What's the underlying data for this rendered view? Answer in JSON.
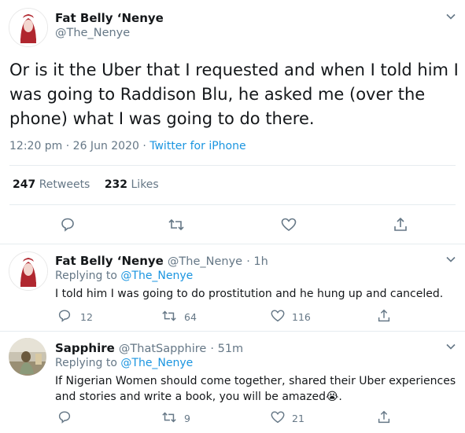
{
  "main_tweet": {
    "author_name": "Fat Belly ‘Nenye",
    "author_handle": "@The_Nenye",
    "text": "Or is it the Uber that I requested and when I told him I was going to Raddison Blu, he asked me (over the phone) what I was going to do there.",
    "time": "12:20 pm · 26 Jun 2020",
    "separator": "·",
    "source": "Twitter for iPhone",
    "retweets_count": "247",
    "retweets_label": "Retweets",
    "likes_count": "232",
    "likes_label": "Likes"
  },
  "replies": [
    {
      "author_name": "Fat Belly ‘Nenye",
      "author_handle": "@The_Nenye",
      "age": "· 1h",
      "replying_prefix": "Replying to",
      "replying_to": "@The_Nenye",
      "text": "I told him I was going to do prostitution and he hung up and canceled.",
      "reply_count": "12",
      "retweet_count": "64",
      "like_count": "116"
    },
    {
      "author_name": "Sapphire",
      "author_handle": "@ThatSapphire",
      "age": "· 51m",
      "replying_prefix": "Replying to",
      "replying_to": "@The_Nenye",
      "text": "If Nigerian Women should come together, shared their Uber experiences and stories and write a book, you will be amazed😭.",
      "reply_count": "",
      "retweet_count": "9",
      "like_count": "21"
    }
  ],
  "colors": {
    "link": "#1b95e0",
    "muted": "#657786",
    "divider": "#e6ecf0",
    "avatar_red": "#b0272f"
  },
  "icons": [
    "reply-icon",
    "retweet-icon",
    "like-icon",
    "share-icon",
    "chevron-down-icon"
  ]
}
